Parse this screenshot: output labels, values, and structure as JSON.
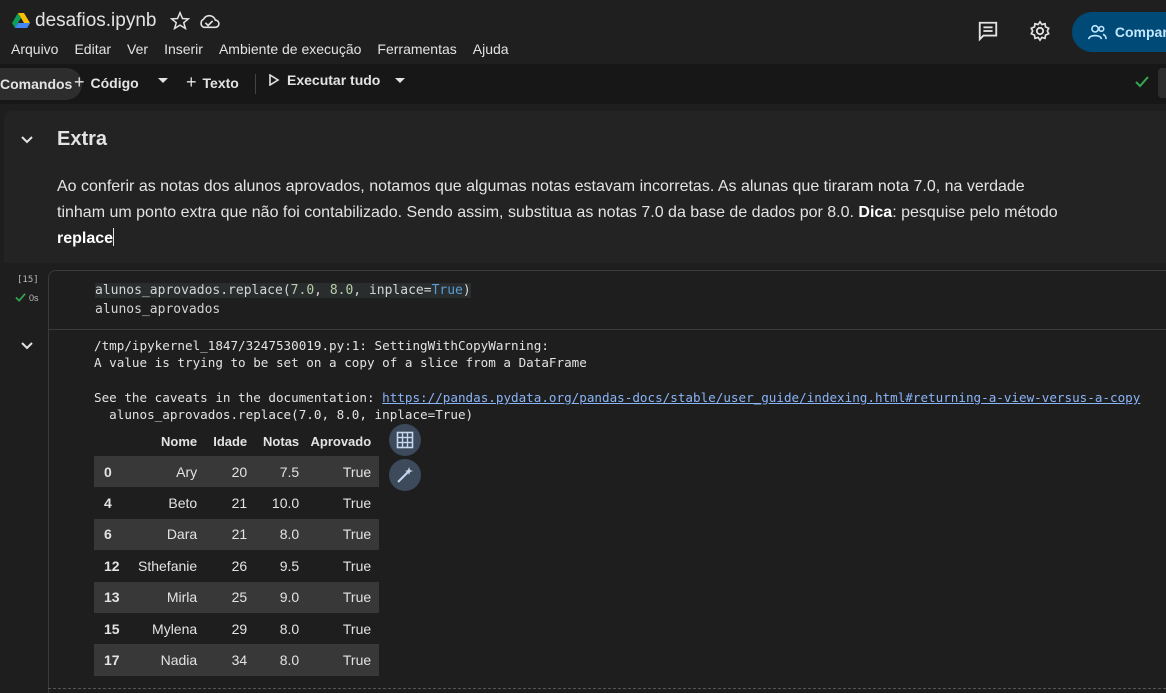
{
  "header": {
    "title": "desafios.ipynb",
    "menu": [
      "Arquivo",
      "Editar",
      "Ver",
      "Inserir",
      "Ambiente de execução",
      "Ferramentas",
      "Ajuda"
    ],
    "share_label": "Compartilhar"
  },
  "toolbar": {
    "commands_label": "Comandos",
    "code_label": "Código",
    "text_label": "Texto",
    "run_all_label": "Executar tudo"
  },
  "text_cell": {
    "heading": "Extra",
    "para_part1": "Ao conferir as notas dos alunos aprovados, notamos que algumas notas estavam incorretas. As alunas que tiraram nota 7.0, na verdade tinham um ponto extra que não foi contabilizado. Sendo assim, substitua as notas 7.0 da base de dados por 8.0. ",
    "para_bold1": "Dica",
    "para_part2": ": pesquise pelo método ",
    "para_bold2": "replace"
  },
  "code_cell": {
    "exec_count": "[15]",
    "exec_time": "0s",
    "line1_a": "alunos_aprovados.replace(",
    "line1_n1": "7.0",
    "line1_b": ", ",
    "line1_n2": "8.0",
    "line1_c": ", inplace=",
    "line1_kw": "True",
    "line1_d": ")",
    "line2": "alunos_aprovados"
  },
  "output": {
    "warn1": "/tmp/ipykernel_1847/3247530019.py:1: SettingWithCopyWarning:",
    "warn2": "A value is trying to be set on a copy of a slice from a DataFrame",
    "warn3_prefix": "See the caveats in the documentation: ",
    "warn3_link": "https://pandas.pydata.org/pandas-docs/stable/user_guide/indexing.html#returning-a-view-versus-a-copy",
    "warn4": "  alunos_aprovados.replace(7.0, 8.0, inplace=True)"
  },
  "dataframe": {
    "columns": [
      "",
      "Nome",
      "Idade",
      "Notas",
      "Aprovado"
    ],
    "rows": [
      [
        "0",
        "Ary",
        "20",
        "7.5",
        "True"
      ],
      [
        "4",
        "Beto",
        "21",
        "10.0",
        "True"
      ],
      [
        "6",
        "Dara",
        "21",
        "8.0",
        "True"
      ],
      [
        "12",
        "Sthefanie",
        "26",
        "9.5",
        "True"
      ],
      [
        "13",
        "Mirla",
        "25",
        "9.0",
        "True"
      ],
      [
        "15",
        "Mylena",
        "29",
        "8.0",
        "True"
      ],
      [
        "17",
        "Nadia",
        "34",
        "8.0",
        "True"
      ]
    ]
  },
  "colors": {
    "accent": "#004a77",
    "link": "#8ab4f8",
    "success": "#34a853"
  }
}
